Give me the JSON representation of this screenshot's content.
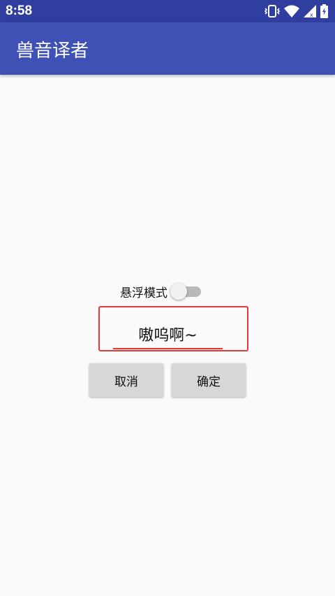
{
  "status_bar": {
    "time": "8:58",
    "icons": [
      "vibrate-icon",
      "wifi-icon",
      "signal-icon",
      "battery-charging-icon"
    ]
  },
  "app_bar": {
    "title": "兽音译者",
    "color": "#3f51b5"
  },
  "float_mode": {
    "label": "悬浮模式",
    "enabled": false
  },
  "input": {
    "value": "嗷呜啊~"
  },
  "buttons": {
    "cancel": "取消",
    "confirm": "确定"
  },
  "colors": {
    "status_bar": "#303f9f",
    "highlight": "#e53935",
    "button_bg": "#d6d7d7"
  }
}
